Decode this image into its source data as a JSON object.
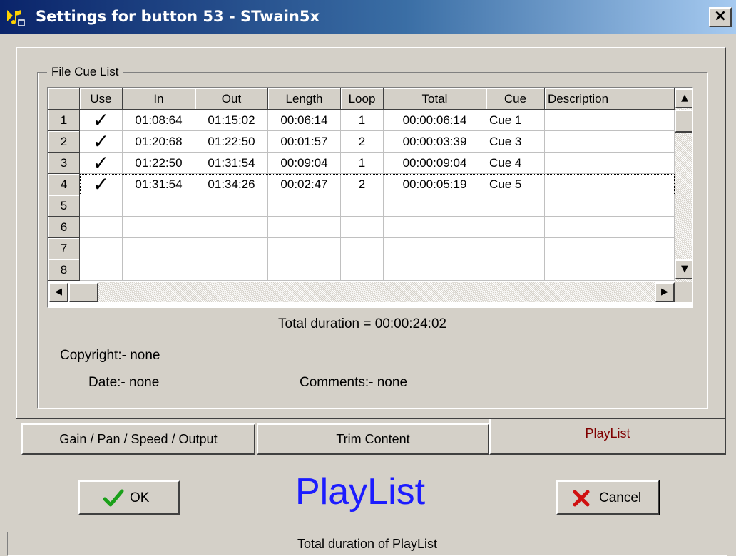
{
  "window": {
    "title": "Settings for button 53 - STwain5x",
    "close_glyph": "×",
    "app_icon": "music-note-icon"
  },
  "group": {
    "title": "File Cue List"
  },
  "grid": {
    "columns": [
      "Use",
      "In",
      "Out",
      "Length",
      "Loop",
      "Total",
      "Cue",
      "Description"
    ],
    "row_numbers": [
      "1",
      "2",
      "3",
      "4",
      "5",
      "6",
      "7",
      "8"
    ],
    "check_glyph": "✓",
    "rows": [
      {
        "use": true,
        "in": "01:08:64",
        "out": "01:15:02",
        "length": "00:06:14",
        "loop": "1",
        "total": "00:00:06:14",
        "cue": "Cue 1",
        "description": ""
      },
      {
        "use": true,
        "in": "01:20:68",
        "out": "01:22:50",
        "length": "00:01:57",
        "loop": "2",
        "total": "00:00:03:39",
        "cue": "Cue 3",
        "description": ""
      },
      {
        "use": true,
        "in": "01:22:50",
        "out": "01:31:54",
        "length": "00:09:04",
        "loop": "1",
        "total": "00:00:09:04",
        "cue": "Cue 4",
        "description": ""
      },
      {
        "use": true,
        "in": "01:31:54",
        "out": "01:34:26",
        "length": "00:02:47",
        "loop": "2",
        "total": "00:00:05:19",
        "cue": "Cue 5",
        "description": ""
      }
    ],
    "scroll_glyphs": {
      "up": "▲",
      "down": "▼",
      "left": "◀",
      "right": "▶"
    }
  },
  "info": {
    "total_duration": "Total duration = 00:00:24:02",
    "copyright": "Copyright:-  none",
    "date": "Date:-  none",
    "comments": "Comments:-   none"
  },
  "tabs": [
    {
      "label": "Gain / Pan / Speed / Output",
      "active": false
    },
    {
      "label": "Trim Content",
      "active": false
    },
    {
      "label": "PlayList",
      "active": true
    }
  ],
  "buttons": {
    "ok": {
      "label": "OK",
      "icon": "checkmark-icon"
    },
    "cancel": {
      "label": "Cancel",
      "icon": "x-icon"
    }
  },
  "page_label": "PlayList",
  "status_bar": "Total duration of PlayList",
  "colors": {
    "title_gradient_start": "#0a246a",
    "title_gradient_end": "#a6caf0",
    "active_tab_text": "#800000",
    "page_label": "#1c1cff",
    "ok_icon": "#1aa01a",
    "cancel_icon": "#d01010"
  }
}
